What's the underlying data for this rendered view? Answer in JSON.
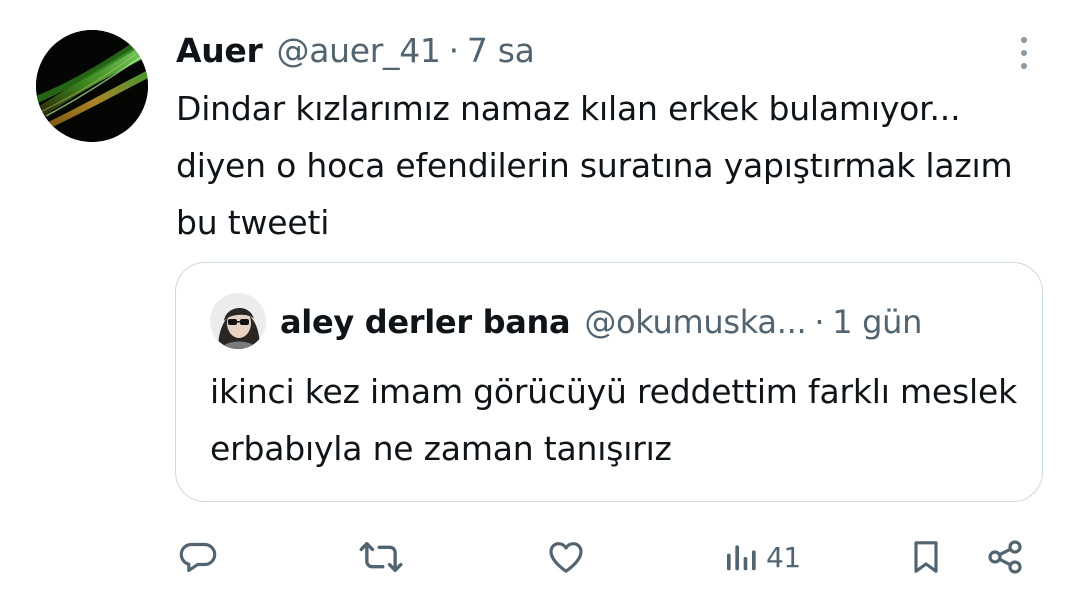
{
  "tweet": {
    "author": {
      "display_name": "Auer",
      "handle": "@auer_41",
      "separator": "·",
      "time": "7 sa"
    },
    "text": "Dindar kızlarımız namaz kılan erkek bulamıyor... diyen o hoca efendilerin suratına yapıştırmak lazım bu tweeti"
  },
  "quote": {
    "author": {
      "display_name": "aley derler bana",
      "handle": "@okumuska...",
      "separator": "·",
      "time": "1 gün"
    },
    "text": "ikinci kez imam görücüyü reddettim farklı meslek erbabıyla ne zaman tanışırız"
  },
  "actions": {
    "reply_icon": "reply-icon",
    "retweet_icon": "retweet-icon",
    "like_icon": "heart-icon",
    "views_icon": "views-bar-chart-icon",
    "views_count": "41",
    "bookmark_icon": "bookmark-icon",
    "share_icon": "share-icon"
  },
  "colors": {
    "text_primary": "#0f1419",
    "text_secondary": "#536471",
    "border": "#cfd9de",
    "background": "#ffffff"
  }
}
